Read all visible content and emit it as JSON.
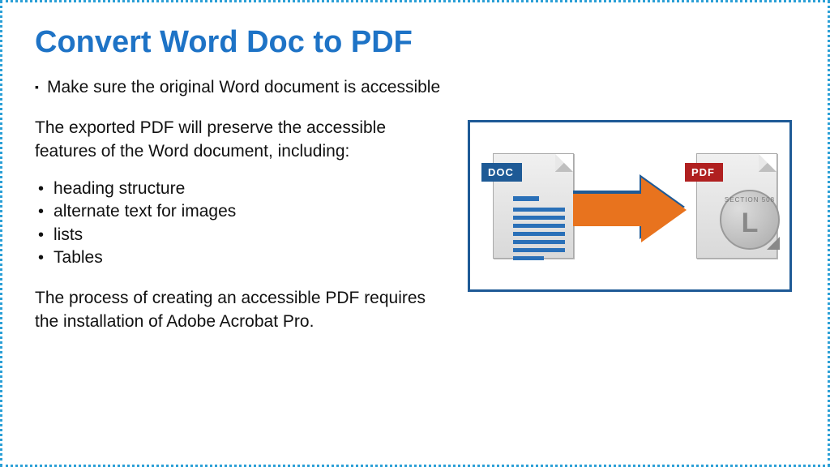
{
  "title": "Convert Word Doc to PDF",
  "bullet1": "Make sure the original Word document is accessible",
  "para1": "The exported PDF will preserve the accessible features of the Word document, including:",
  "features": {
    "0": "heading structure",
    "1": "alternate text for images",
    "2": "lists",
    "3": "Tables"
  },
  "para2": "The process of creating an accessible PDF requires the installation of Adobe Acrobat Pro.",
  "illustration": {
    "doc_label": "DOC",
    "pdf_label": "PDF",
    "seal_text": "SECTION 508",
    "seal_letter": "L"
  }
}
